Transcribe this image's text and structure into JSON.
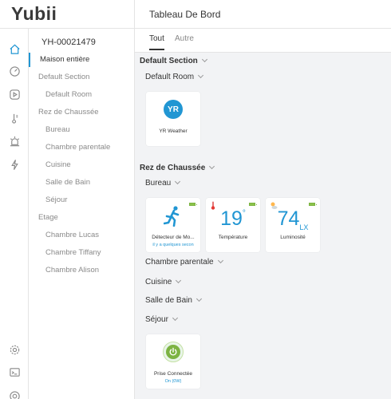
{
  "app": {
    "logo": "Yubii",
    "header_title": "Tableau De Bord"
  },
  "sidebar": {
    "device_id": "YH-00021479",
    "items": [
      {
        "label": "Maison entière",
        "active": true,
        "level": 1
      },
      {
        "label": "Default Section",
        "level": 1
      },
      {
        "label": "Default Room",
        "level": 2
      },
      {
        "label": "Rez de Chaussée",
        "level": 1
      },
      {
        "label": "Bureau",
        "level": 2
      },
      {
        "label": "Chambre parentale",
        "level": 2
      },
      {
        "label": "Cuisine",
        "level": 2
      },
      {
        "label": "Salle de Bain",
        "level": 2
      },
      {
        "label": "Séjour",
        "level": 2
      },
      {
        "label": "Etage",
        "level": 1
      },
      {
        "label": "Chambre Lucas",
        "level": 2
      },
      {
        "label": "Chambre Tiffany",
        "level": 2
      },
      {
        "label": "Chambre Alison",
        "level": 2
      }
    ]
  },
  "rail_icons": [
    "home-icon",
    "speedometer-icon",
    "play-icon",
    "thermometer-icon",
    "alarm-light-icon",
    "bolt-icon",
    "settings-icon",
    "terminal-icon",
    "support-icon"
  ],
  "tabs": [
    {
      "label": "Tout",
      "active": true
    },
    {
      "label": "Autre",
      "active": false
    }
  ],
  "sections": [
    {
      "title": "Default Section",
      "rooms": [
        {
          "name": "Default Room",
          "cards": [
            {
              "type": "weather",
              "icon_text": "YR",
              "label": "YR Weather"
            }
          ]
        }
      ]
    },
    {
      "title": "Rez de Chaussée",
      "rooms": [
        {
          "name": "Bureau",
          "cards": [
            {
              "type": "motion",
              "label": "Détecteur de Mo...",
              "sub": "il y a quelques secon"
            },
            {
              "type": "temperature",
              "value": "19",
              "unit": "°",
              "label": "Température"
            },
            {
              "type": "luminosity",
              "value": "74",
              "unit": "LX",
              "label": "Luminosité"
            }
          ]
        },
        {
          "name": "Chambre parentale",
          "cards": []
        },
        {
          "name": "Cuisine",
          "cards": []
        },
        {
          "name": "Salle de Bain",
          "cards": []
        },
        {
          "name": "Séjour",
          "cards": [
            {
              "type": "plug",
              "label": "Prise Connectée",
              "sub": "On (0W)"
            }
          ]
        }
      ]
    }
  ],
  "colors": {
    "accent": "#2196d3",
    "battery": "#8bc34a",
    "plug_green": "#7cb342"
  }
}
